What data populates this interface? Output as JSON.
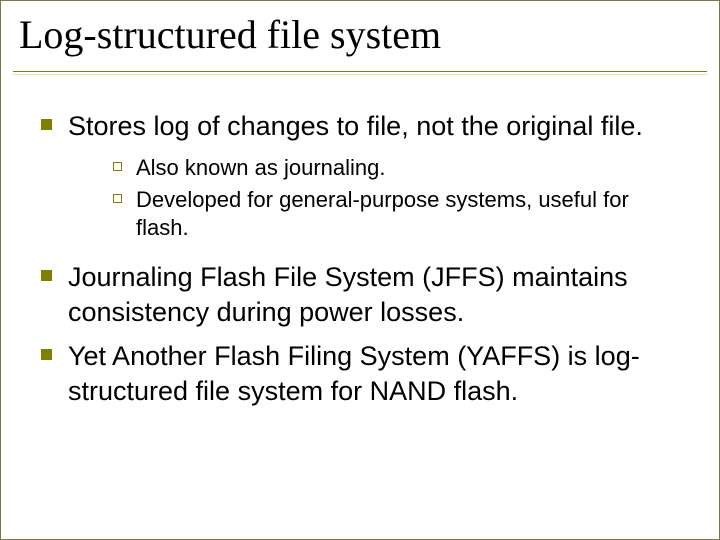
{
  "title": "Log-structured file system",
  "bullets": [
    {
      "text": "Stores log of changes to file, not the original file.",
      "sub": [
        "Also known as journaling.",
        "Developed for general-purpose systems, useful for flash."
      ]
    },
    {
      "text": "Journaling Flash File System (JFFS) maintains consistency during power losses.",
      "sub": []
    },
    {
      "text": "Yet Another Flash Filing System (YAFFS) is log-structured file system for NAND flash.",
      "sub": []
    }
  ]
}
